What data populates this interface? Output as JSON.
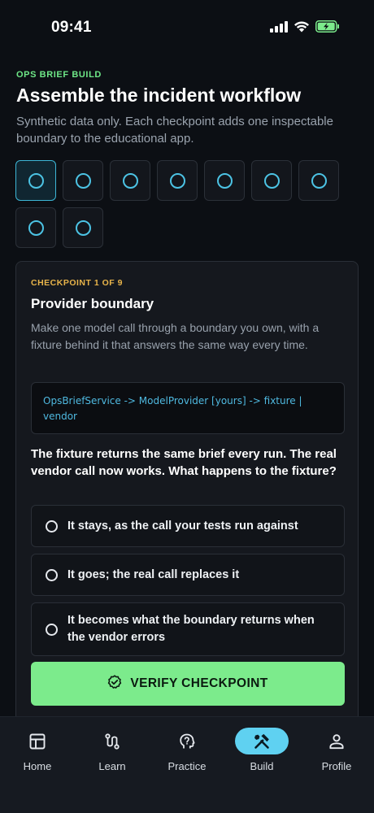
{
  "status_bar": {
    "time": "09:41"
  },
  "header": {
    "eyebrow": "OPS BRIEF BUILD",
    "title": "Assemble the incident workflow",
    "subtitle": "Synthetic data only. Each checkpoint adds one inspectable boundary to the educational app."
  },
  "checkpoints": {
    "total": 9,
    "current": 1
  },
  "card": {
    "eyebrow": "CHECKPOINT 1 OF 9",
    "title": "Provider boundary",
    "description": "Make one model call through a boundary you own, with a fixture behind it that answers the same way every time.",
    "code": "OpsBriefService -> ModelProvider [yours] -> fixture | vendor",
    "question": "The fixture returns the same brief every run. The real vendor call now works. What happens to the fixture?",
    "options": [
      {
        "label": "It stays, as the call your tests run against"
      },
      {
        "label": "It goes; the real call replaces it"
      },
      {
        "label": "It becomes what the boundary returns when the vendor errors"
      }
    ],
    "verify_label": "VERIFY CHECKPOINT"
  },
  "nav": {
    "items": [
      {
        "label": "Home",
        "icon": "home-icon"
      },
      {
        "label": "Learn",
        "icon": "path-icon"
      },
      {
        "label": "Practice",
        "icon": "brain-icon"
      },
      {
        "label": "Build",
        "icon": "tools-icon"
      },
      {
        "label": "Profile",
        "icon": "person-icon"
      }
    ],
    "active": "Build"
  },
  "colors": {
    "accent_green": "#7ceb8c",
    "accent_cyan": "#5fd1f1",
    "checkpoint_amber": "#e8b44a",
    "background": "#0c0f14"
  }
}
